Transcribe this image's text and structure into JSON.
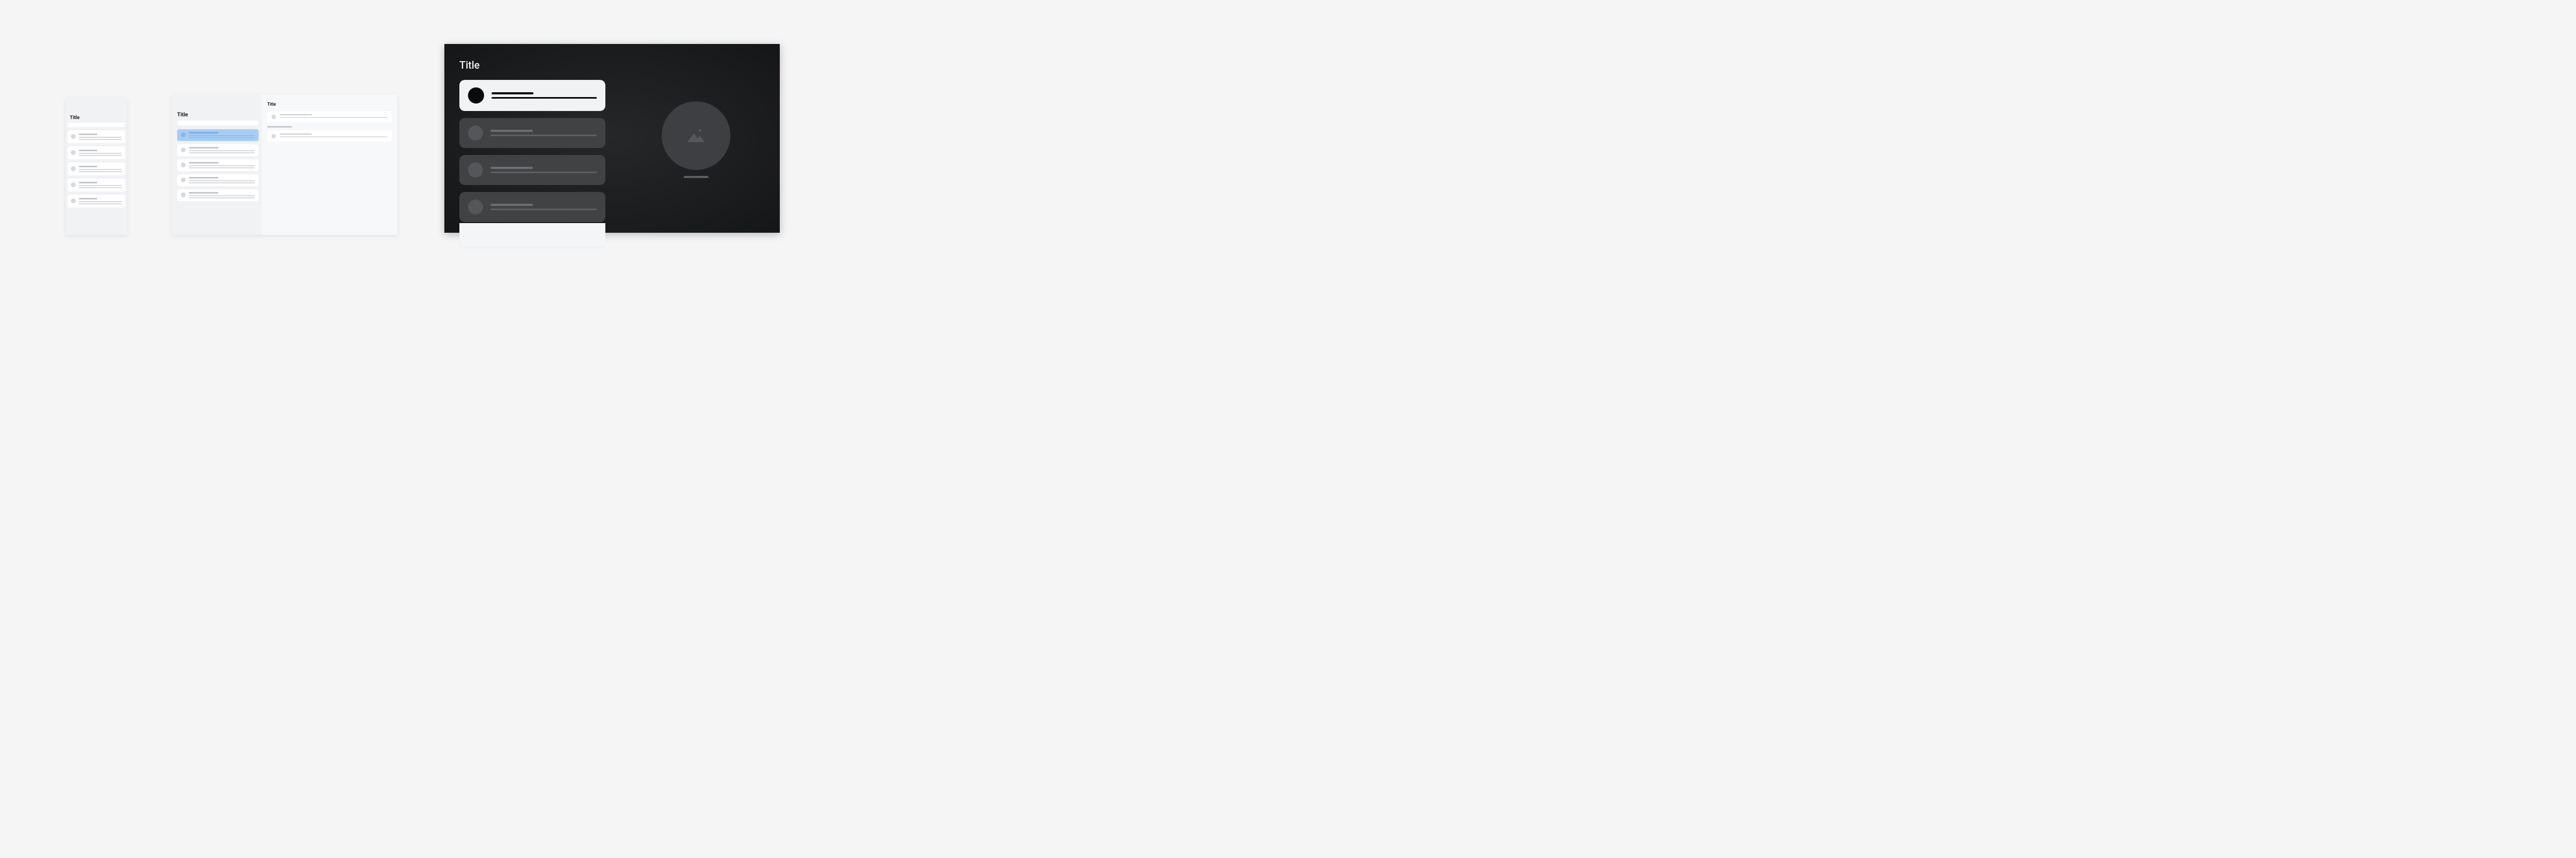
{
  "mobile": {
    "title": "Title",
    "items": [
      {},
      {},
      {},
      {},
      {}
    ]
  },
  "tablet": {
    "left": {
      "title": "Title",
      "items": [
        {
          "selected": true
        },
        {},
        {},
        {},
        {}
      ]
    },
    "right": {
      "title": "Title",
      "items": [
        {},
        {}
      ]
    }
  },
  "tv": {
    "title": "Title",
    "items": [
      {
        "focused": true
      },
      {},
      {},
      {},
      {}
    ]
  }
}
